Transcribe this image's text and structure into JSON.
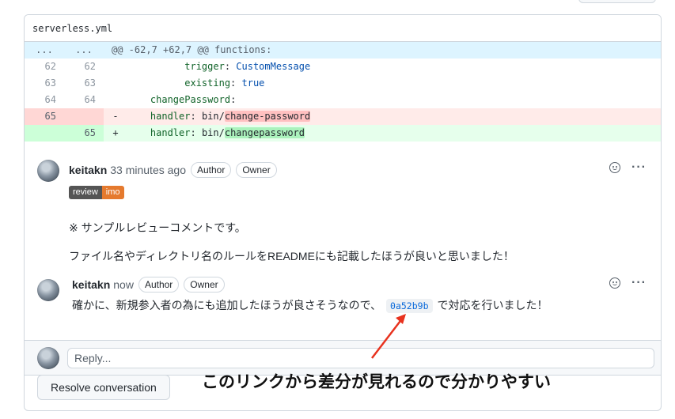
{
  "file": {
    "name": "serverless.yml"
  },
  "diff": {
    "hunk": {
      "left": "...",
      "right": "...",
      "text": "@@ -62,7 +62,7 @@ functions:"
    },
    "lines": [
      {
        "type": "ctx",
        "old": "62",
        "new": "62",
        "indent": "          ",
        "key": "trigger",
        "sep": ": ",
        "value": "CustomMessage"
      },
      {
        "type": "ctx",
        "old": "63",
        "new": "63",
        "indent": "          ",
        "key": "existing",
        "sep": ": ",
        "value": "true"
      },
      {
        "type": "ctx",
        "old": "64",
        "new": "64",
        "indent": "    ",
        "key": "changePassword",
        "sep": ":",
        "value": ""
      },
      {
        "type": "del",
        "old": "65",
        "new": "",
        "sign": "-",
        "indent": "    ",
        "key": "handler",
        "sep": ": ",
        "value_prefix": "bin/",
        "value_hl": "change-password"
      },
      {
        "type": "add",
        "old": "",
        "new": "65",
        "sign": "+",
        "indent": "    ",
        "key": "handler",
        "sep": ": ",
        "value_prefix": "bin/",
        "value_hl": "changepassword"
      }
    ]
  },
  "comments": [
    {
      "author": "keitakn",
      "time": "33 minutes ago",
      "badges": [
        "Author",
        "Owner"
      ],
      "labels": {
        "review": "review",
        "imo": "imo"
      },
      "body": [
        "※ サンプルレビューコメントです。",
        "ファイル名やディレクトリ名のルールをREADMEにも記載したほうが良いと思いました！"
      ]
    },
    {
      "author": "keitakn",
      "time": "now",
      "badges": [
        "Author",
        "Owner"
      ],
      "body_before": "確かに、新規参入者の為にも追加したほうが良さそうなので、",
      "sha": "0a52b9b",
      "body_after": "で対応を行いました！"
    }
  ],
  "reply": {
    "placeholder": "Reply..."
  },
  "resolve_button": "Resolve conversation",
  "annotation": "このリンクから差分が見れるので分かりやすい",
  "colors": {
    "arrow": "#e8321e",
    "link": "#0969da",
    "label_imo": "#e57a2e",
    "label_review": "#555555"
  }
}
